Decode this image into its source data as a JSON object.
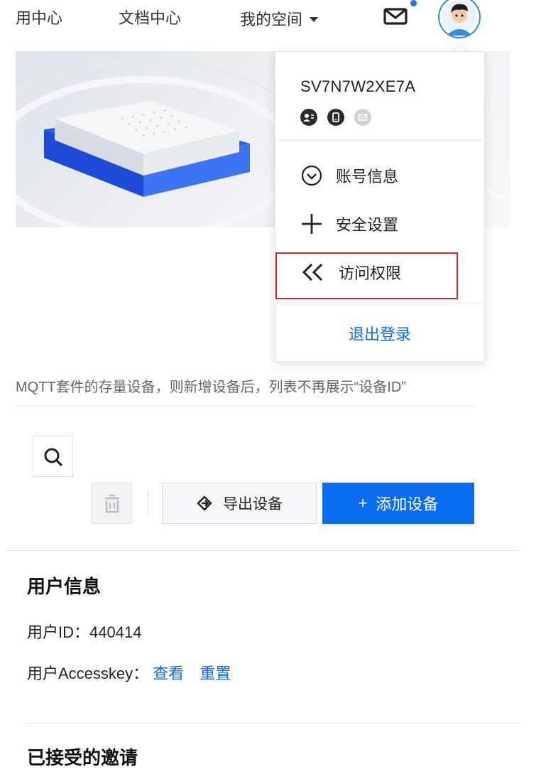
{
  "nav": {
    "items": [
      "用中心",
      "文档中心"
    ],
    "space_label": "我的空间",
    "mail_icon": "mail-icon",
    "has_notification": true
  },
  "dropdown": {
    "username": "SV7N7W2XE7A",
    "badges": [
      "contact-badge-icon",
      "phone-badge-icon",
      "message-badge-icon"
    ],
    "items": [
      {
        "label": "账号信息",
        "icon": "chevron-down-circle-icon"
      },
      {
        "label": "安全设置",
        "icon": "plus-icon"
      },
      {
        "label": "访问权限",
        "icon": "double-chevron-left-icon"
      }
    ],
    "logout_label": "退出登录"
  },
  "notice": "MQTT套件的存量设备，则新增设备后，列表不再展示“设备ID”",
  "toolbar": {
    "export_label": "导出设备",
    "add_label": "添加设备",
    "add_prefix": "+"
  },
  "user_info": {
    "title": "用户信息",
    "id_label": "用户ID：",
    "id_value": "440414",
    "accesskey_label": "用户Accesskey：",
    "view_link": "查看",
    "reset_link": "重置"
  },
  "invites": {
    "title": "已接受的邀请"
  },
  "colors": {
    "primary": "#0a6cf0",
    "highlight_border": "#e0242f"
  }
}
